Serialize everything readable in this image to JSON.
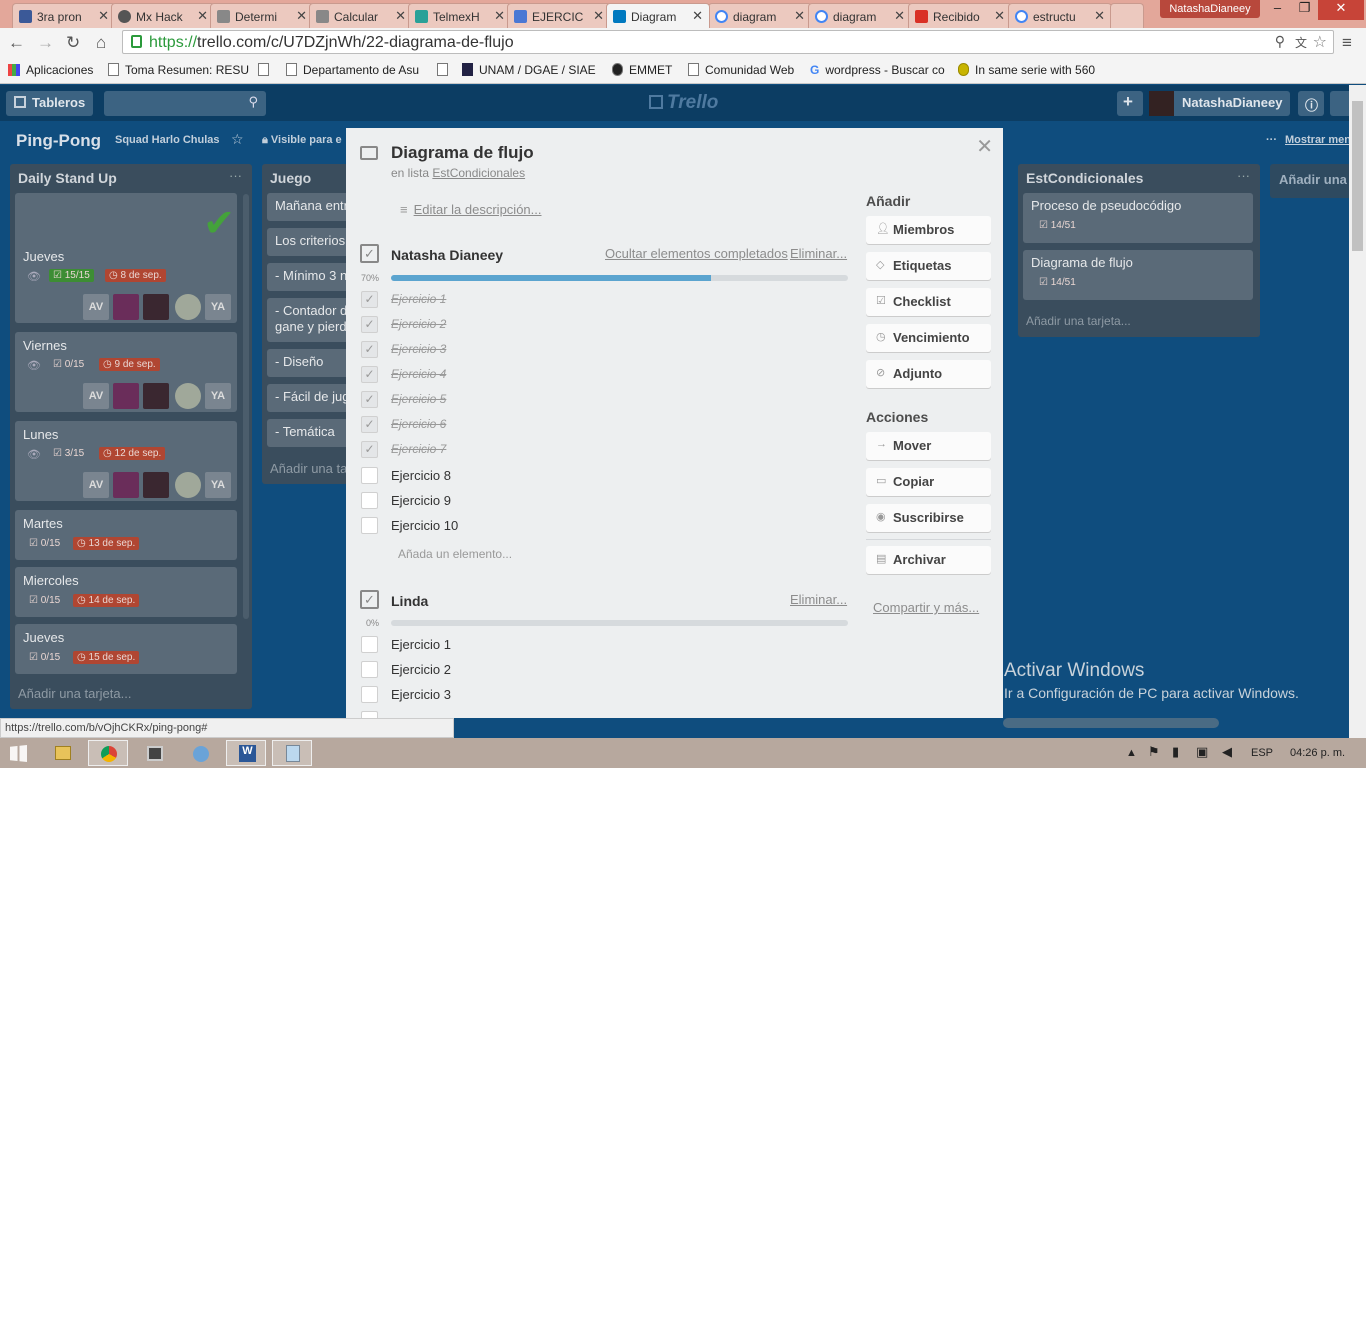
{
  "browser": {
    "tabs": [
      {
        "label": "3ra pron"
      },
      {
        "label": "Mx Hack"
      },
      {
        "label": "Determi"
      },
      {
        "label": "Calcular"
      },
      {
        "label": "TelmexH"
      },
      {
        "label": "EJERCIC"
      },
      {
        "label": "Diagram"
      },
      {
        "label": "diagram"
      },
      {
        "label": "diagram"
      },
      {
        "label": "Recibido"
      },
      {
        "label": "estructu"
      }
    ],
    "profile": "NatashaDianeey",
    "url_scheme": "https://",
    "url_rest": "trello.com/c/U7DZjnWh/22-diagrama-de-flujo",
    "bookmarks": [
      "Aplicaciones",
      "Toma Resumen: RESU",
      "Departamento de Asu",
      "UNAM / DGAE / SIAE",
      "EMMET",
      "Comunidad Web",
      "wordpress - Buscar co",
      "In same serie with 560"
    ],
    "status_url": "https://trello.com/b/vOjhCKRx/ping-pong#"
  },
  "trello": {
    "boards_label": "Tableros",
    "logo": "Trello",
    "user": "NatashaDianeey",
    "board_title": "Ping-Pong",
    "team": "Squad Harlo Chulas",
    "visibility": "Visible para e",
    "show_menu": "Mostrar menú"
  },
  "lists": {
    "daily": {
      "title": "Daily Stand Up",
      "cards": [
        {
          "title": "Jueves",
          "check": "15/15",
          "due": "8 de sep."
        },
        {
          "title": "Viernes",
          "check": "0/15",
          "due": "9 de sep."
        },
        {
          "title": "Lunes",
          "check": "3/15",
          "due": "12 de sep."
        },
        {
          "title": "Martes",
          "check": "0/15",
          "due": "13 de sep."
        },
        {
          "title": "Miercoles",
          "check": "0/15",
          "due": "14 de sep."
        },
        {
          "title": "Jueves",
          "check": "0/15",
          "due": "15 de sep."
        }
      ],
      "avatars": [
        "AV",
        "YA"
      ],
      "add": "Añadir una tarjeta..."
    },
    "juego": {
      "title": "Juego",
      "cards": [
        "Mañana entr",
        "Los criterios",
        "- Mínimo 3 n",
        "- Contador d",
        "gane y pierd",
        "- Diseño",
        "- Fácil de jug",
        "- Temática"
      ],
      "add": "Añadir una ta"
    },
    "estc": {
      "title": "EstCondicionales",
      "cards": [
        {
          "title": "Proceso de pseudocódigo",
          "check": "14/51"
        },
        {
          "title": "Diagrama de flujo",
          "check": "14/51"
        }
      ],
      "add": "Añadir una tarjeta..."
    },
    "new_list": "Añadir una li"
  },
  "modal": {
    "title": "Diagrama de flujo",
    "in_list_prefix": "en lista",
    "in_list": "EstCondicionales",
    "edit_desc": "Editar la descripción...",
    "checklist1": {
      "title": "Natasha Dianeey",
      "hide": "Ocultar elementos completados",
      "delete": "Eliminar...",
      "percent": "70%",
      "progress": 0.7,
      "items": [
        "Ejercicio 1",
        "Ejercicio 2",
        "Ejercicio 3",
        "Ejercicio 4",
        "Ejercicio 5",
        "Ejercicio 6",
        "Ejercicio 7",
        "Ejercicio 8",
        "Ejercicio 9",
        "Ejercicio 10"
      ],
      "add": "Añada un elemento..."
    },
    "checklist2": {
      "title": "Linda",
      "delete": "Eliminar...",
      "percent": "0%",
      "progress": 0,
      "items": [
        "Ejercicio 1",
        "Ejercicio 2",
        "Ejercicio 3"
      ]
    },
    "add_title": "Añadir",
    "add_buttons": [
      "Miembros",
      "Etiquetas",
      "Checklist",
      "Vencimiento",
      "Adjunto"
    ],
    "actions_title": "Acciones",
    "action_buttons": [
      "Mover",
      "Copiar",
      "Suscribirse",
      "Archivar"
    ],
    "share": "Compartir y más..."
  },
  "windows": {
    "activate_title": "Activar Windows",
    "activate_sub": "Ir a Configuración de PC para activar Windows.",
    "lang": "ESP",
    "time": "04:26 p. m."
  },
  "colors": {
    "accent": "#5ba4cf",
    "board_bg": "#0f4d7e",
    "due_red": "#b04632",
    "done_green": "#3d8d34"
  }
}
